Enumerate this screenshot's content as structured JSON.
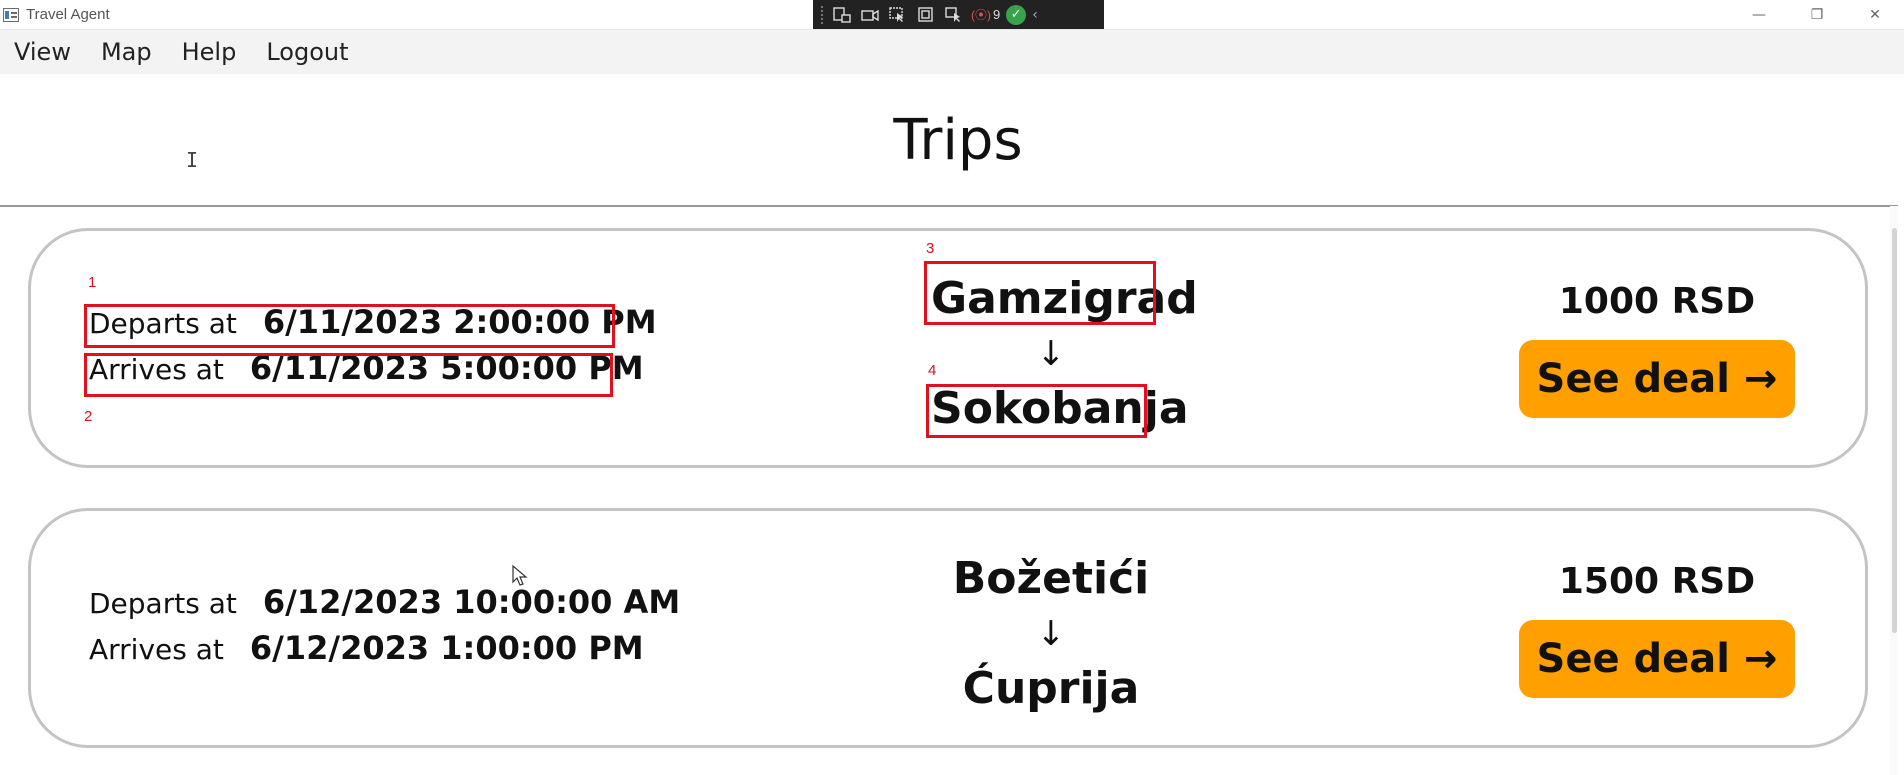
{
  "window": {
    "title": "Travel Agent",
    "debug_toolbar": {
      "count": "9"
    },
    "controls": {
      "minimize": "—",
      "restore": "❐",
      "close": "✕"
    }
  },
  "menu": {
    "items": [
      "View",
      "Map",
      "Help",
      "Logout"
    ]
  },
  "page": {
    "title": "Trips"
  },
  "trips": [
    {
      "departs_label": "Departs at",
      "departs_value": "6/11/2023 2:00:00 PM",
      "arrives_label": "Arrives at",
      "arrives_value": "6/11/2023 5:00:00 PM",
      "from": "Gamzigrad",
      "arrow": "↓",
      "to": "Sokobanja",
      "price": "1000 RSD",
      "button_label": "See deal →"
    },
    {
      "departs_label": "Departs at",
      "departs_value": "6/12/2023 10:00:00 AM",
      "arrives_label": "Arrives at",
      "arrives_value": "6/12/2023 1:00:00 PM",
      "from": "Božetići",
      "arrow": "↓",
      "to": "Ćuprija",
      "price": "1500 RSD",
      "button_label": "See deal →"
    }
  ],
  "annotations": [
    "1",
    "2",
    "3",
    "4"
  ],
  "colors": {
    "accent_button": "#ffa000",
    "annotation": "#e0101c",
    "card_border": "#c4c4c4"
  }
}
